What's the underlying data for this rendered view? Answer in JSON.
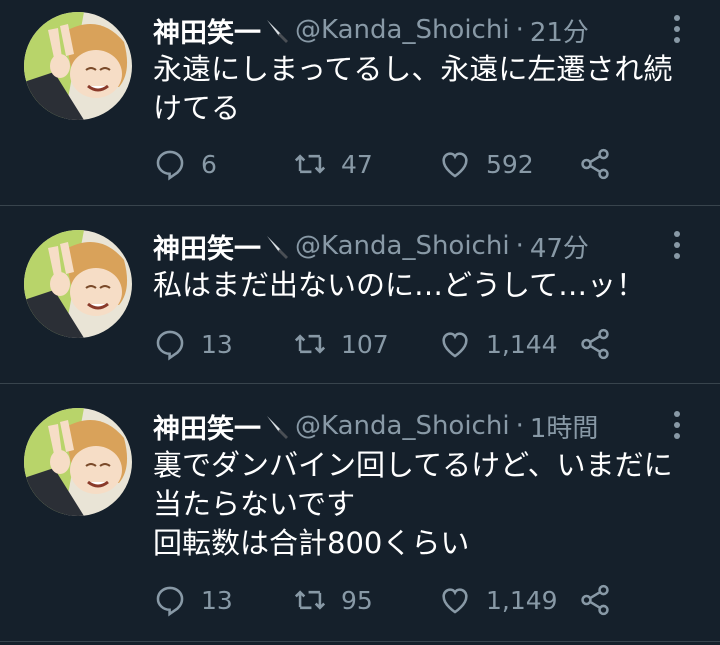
{
  "tweets": [
    {
      "name": "神田笑一",
      "handle": "@Kanda_Shoichi",
      "separator": "·",
      "time": "21分",
      "text": "永遠にしまってるし、永遠に左遷され続\nけてる",
      "replies": "6",
      "retweets": "47",
      "likes": "592"
    },
    {
      "name": "神田笑一",
      "handle": "@Kanda_Shoichi",
      "separator": "·",
      "time": "47分",
      "text": "私はまだ出ないのに…どうして…ッ！",
      "replies": "13",
      "retweets": "107",
      "likes": "1,144"
    },
    {
      "name": "神田笑一",
      "handle": "@Kanda_Shoichi",
      "separator": "·",
      "time": "1時間",
      "text": "裏でダンバイン回してるけど、いまだに\n当たらないです\n回転数は合計800くらい",
      "replies": "13",
      "retweets": "95",
      "likes": "1,149"
    }
  ],
  "icons": {
    "reply": "reply-icon",
    "retweet": "retweet-icon",
    "like": "heart-icon",
    "share": "share-icon",
    "more": "more-vertical-icon",
    "knife": "knife-icon"
  },
  "colors": {
    "background": "#15202b",
    "text": "#ffffff",
    "secondary": "#8899a6",
    "divider": "#38444d"
  }
}
